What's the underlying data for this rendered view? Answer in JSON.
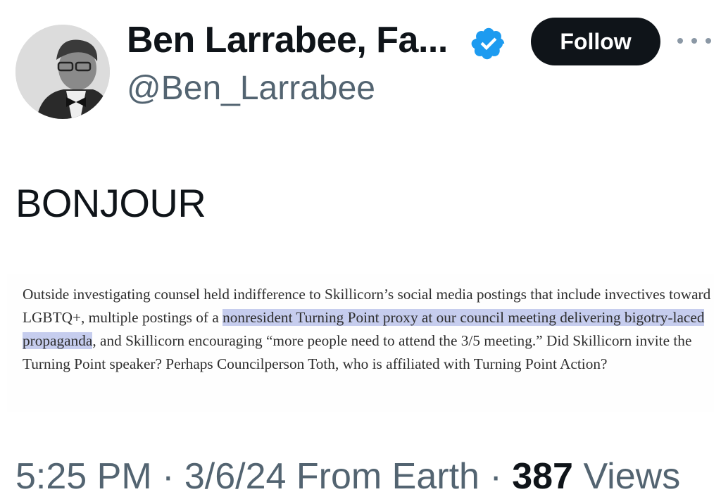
{
  "author": {
    "display_name": "Ben Larrabee, Fa...",
    "handle": "@Ben_Larrabee",
    "follow_label": "Follow",
    "verified_color": "#1d9bf0"
  },
  "tweet": {
    "text": "BONJOUR",
    "clipping": {
      "before": "Outside investigating counsel held indifference to Skillicorn’s social media postings that include invectives toward LGBTQ+, multiple postings of a ",
      "highlighted": "nonresident Turning Point proxy at our council meeting delivering bigotry-laced propaganda",
      "after": ", and Skillicorn encouraging “more people need to attend the 3/5 meeting.” Did Skillicorn invite the Turning Point speaker? Perhaps Councilperson Toth, who is affiliated with Turning Point Action?",
      "highlight_color": "#c6cdee"
    }
  },
  "meta": {
    "time": "5:25 PM",
    "date": "3/6/24",
    "location": "From Earth",
    "views_count": "387",
    "views_label": "Views",
    "separator": "·"
  },
  "icons": {
    "verified": "verified-badge-icon",
    "more": "more-options-icon"
  }
}
